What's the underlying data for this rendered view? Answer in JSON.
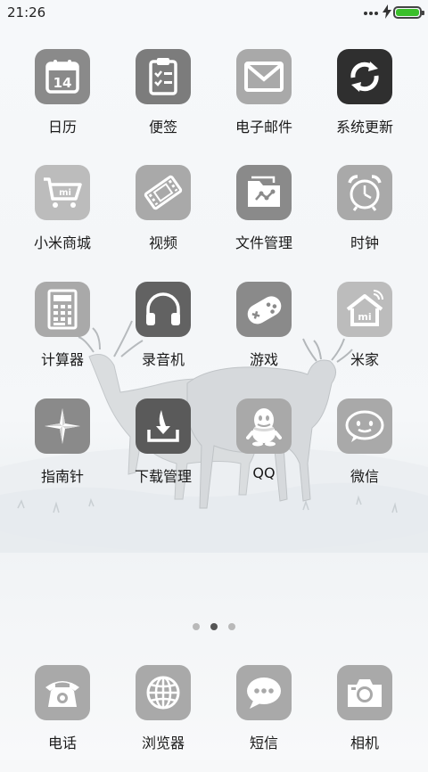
{
  "status_bar": {
    "time": "21:26",
    "battery_level": 1.0,
    "battery_color": "#3bbf2a",
    "charging": true
  },
  "home": {
    "apps": [
      {
        "label": "日历",
        "icon": "calendar-icon",
        "icon_text": "14"
      },
      {
        "label": "便签",
        "icon": "notes-icon"
      },
      {
        "label": "电子邮件",
        "icon": "mail-icon"
      },
      {
        "label": "系统更新",
        "icon": "update-icon"
      },
      {
        "label": "小米商城",
        "icon": "mi-store-icon",
        "icon_text": "mi"
      },
      {
        "label": "视频",
        "icon": "video-icon"
      },
      {
        "label": "文件管理",
        "icon": "file-manager-icon"
      },
      {
        "label": "时钟",
        "icon": "clock-icon"
      },
      {
        "label": "计算器",
        "icon": "calculator-icon"
      },
      {
        "label": "录音机",
        "icon": "headphones-icon"
      },
      {
        "label": "游戏",
        "icon": "game-icon"
      },
      {
        "label": "米家",
        "icon": "mi-home-icon",
        "icon_text": "mi"
      },
      {
        "label": "指南针",
        "icon": "compass-icon"
      },
      {
        "label": "下载管理",
        "icon": "download-icon"
      },
      {
        "label": "QQ",
        "icon": "qq-icon"
      },
      {
        "label": "微信",
        "icon": "wechat-icon"
      }
    ],
    "page_indicator": {
      "count": 3,
      "active": 2
    }
  },
  "dock": {
    "apps": [
      {
        "label": "电话",
        "icon": "phone-icon"
      },
      {
        "label": "浏览器",
        "icon": "browser-icon"
      },
      {
        "label": "短信",
        "icon": "messages-icon"
      },
      {
        "label": "相机",
        "icon": "camera-icon"
      }
    ]
  }
}
